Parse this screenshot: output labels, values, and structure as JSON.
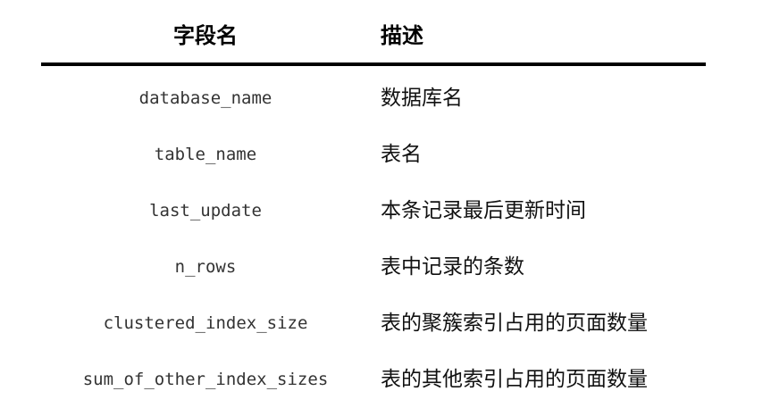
{
  "table": {
    "headers": {
      "field": "字段名",
      "description": "描述"
    },
    "rows": [
      {
        "field": "database_name",
        "description": "数据库名"
      },
      {
        "field": "table_name",
        "description": "表名"
      },
      {
        "field": "last_update",
        "description": "本条记录最后更新时间"
      },
      {
        "field": "n_rows",
        "description": "表中记录的条数"
      },
      {
        "field": "clustered_index_size",
        "description": "表的聚簇索引占用的页面数量"
      },
      {
        "field": "sum_of_other_index_sizes",
        "description": "表的其他索引占用的页面数量"
      }
    ]
  }
}
